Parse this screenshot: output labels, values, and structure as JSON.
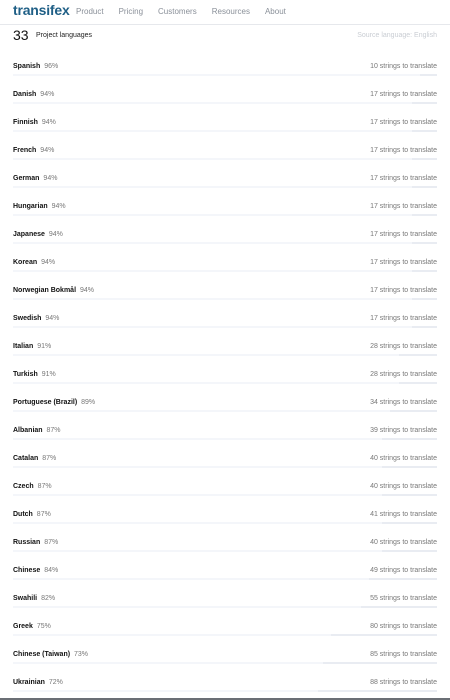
{
  "nav": {
    "logo": "transifex",
    "links": [
      "Product",
      "Pricing",
      "Customers",
      "Resources",
      "About"
    ]
  },
  "header": {
    "count": "33",
    "label": "Project languages",
    "source": "Source language: English"
  },
  "languages": [
    {
      "name": "Spanish",
      "percent": "96%",
      "strings": "10 strings to translate"
    },
    {
      "name": "Danish",
      "percent": "94%",
      "strings": "17 strings to translate"
    },
    {
      "name": "Finnish",
      "percent": "94%",
      "strings": "17 strings to translate"
    },
    {
      "name": "French",
      "percent": "94%",
      "strings": "17 strings to translate"
    },
    {
      "name": "German",
      "percent": "94%",
      "strings": "17 strings to translate"
    },
    {
      "name": "Hungarian",
      "percent": "94%",
      "strings": "17 strings to translate"
    },
    {
      "name": "Japanese",
      "percent": "94%",
      "strings": "17 strings to translate"
    },
    {
      "name": "Korean",
      "percent": "94%",
      "strings": "17 strings to translate"
    },
    {
      "name": "Norwegian Bokmål",
      "percent": "94%",
      "strings": "17 strings to translate"
    },
    {
      "name": "Swedish",
      "percent": "94%",
      "strings": "17 strings to translate"
    },
    {
      "name": "Italian",
      "percent": "91%",
      "strings": "28 strings to translate"
    },
    {
      "name": "Turkish",
      "percent": "91%",
      "strings": "28 strings to translate"
    },
    {
      "name": "Portuguese (Brazil)",
      "percent": "89%",
      "strings": "34 strings to translate"
    },
    {
      "name": "Albanian",
      "percent": "87%",
      "strings": "39 strings to translate"
    },
    {
      "name": "Catalan",
      "percent": "87%",
      "strings": "40 strings to translate"
    },
    {
      "name": "Czech",
      "percent": "87%",
      "strings": "40 strings to translate"
    },
    {
      "name": "Dutch",
      "percent": "87%",
      "strings": "41 strings to translate"
    },
    {
      "name": "Russian",
      "percent": "87%",
      "strings": "40 strings to translate"
    },
    {
      "name": "Chinese",
      "percent": "84%",
      "strings": "49 strings to translate"
    },
    {
      "name": "Swahili",
      "percent": "82%",
      "strings": "55 strings to translate"
    },
    {
      "name": "Greek",
      "percent": "75%",
      "strings": "80 strings to translate"
    },
    {
      "name": "Chinese (Taiwan)",
      "percent": "73%",
      "strings": "85 strings to translate"
    },
    {
      "name": "Ukrainian",
      "percent": "72%",
      "strings": "88 strings to translate"
    }
  ],
  "colors": {
    "logo": "#1f5f86",
    "bar_track": "#e9ecf2",
    "bar_fill": "#f4f6fa"
  }
}
